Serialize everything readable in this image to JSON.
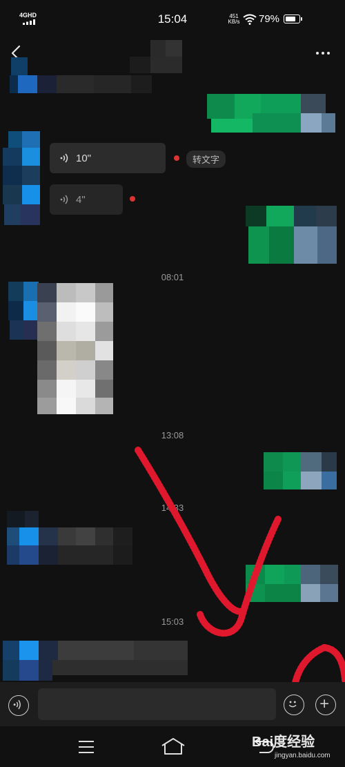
{
  "status_bar": {
    "network": "4GHD",
    "time": "15:04",
    "speed_value": "451",
    "speed_unit": "KB/s",
    "battery": "79%",
    "battery_level": 0.79
  },
  "header": {
    "back_icon": "chevron-left-icon",
    "more_icon": "more-dots-icon"
  },
  "messages": {
    "voice_1_duration": "10\"",
    "voice_1_action": "转文字",
    "voice_2_duration": "4\""
  },
  "timestamps": [
    "08:01",
    "13:08",
    "14:33",
    "15:03"
  ],
  "input_bar": {
    "voice_icon": "voice-input-icon",
    "emoji_icon": "emoji-icon",
    "plus_icon": "plus-icon",
    "placeholder": ""
  },
  "nav": {
    "menu_icon": "menu-icon",
    "home_icon": "home-icon",
    "back_icon": "back-icon"
  },
  "watermark": {
    "brand": "Bai度经验",
    "url": "jingyan.baidu.com"
  },
  "colors": {
    "background": "#111111",
    "bubble_out": "#07c160",
    "bubble_in": "#2c2c2c",
    "annotation": "#e0182d"
  }
}
